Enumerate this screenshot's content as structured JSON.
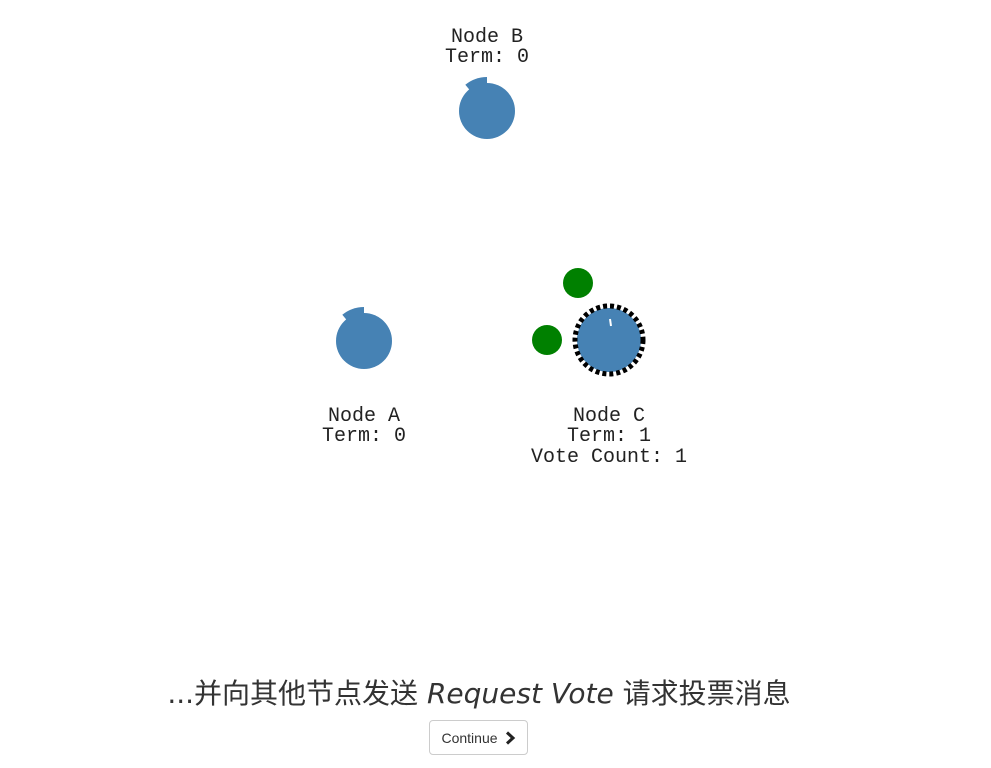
{
  "colors": {
    "node_fill": "#4682b4",
    "vote_message": "#008000",
    "candidate_ring": "#000000",
    "text": "#222222"
  },
  "nodes": [
    {
      "name": "Node B",
      "term_label": "Term: 0",
      "timeout_remaining": 0.96,
      "role": "follower"
    },
    {
      "name": "Node A",
      "term_label": "Term: 0",
      "timeout_remaining": 0.9,
      "role": "follower"
    },
    {
      "name": "Node C",
      "term_label": "Term: 1",
      "vote_count_label": "Vote Count: 1",
      "timeout_remaining": 0.98,
      "role": "candidate"
    }
  ],
  "messages": [
    {
      "type": "request-vote",
      "from": "Node C",
      "to": "Node B"
    },
    {
      "type": "request-vote",
      "from": "Node C",
      "to": "Node A"
    }
  ],
  "caption": {
    "prefix": "...并向其他节点发送 ",
    "emphasis": "Request Vote",
    "suffix": " 请求投票消息"
  },
  "controls": {
    "continue_label": "Continue",
    "continue_icon": "chevron-right-icon"
  }
}
